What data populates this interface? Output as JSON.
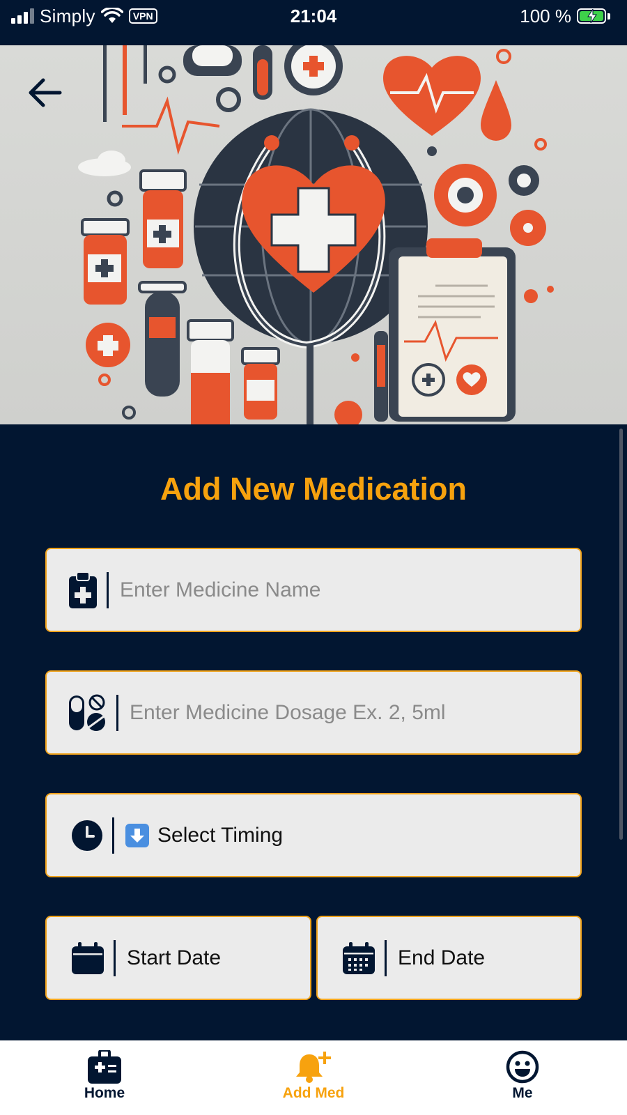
{
  "status_bar": {
    "carrier": "Simply",
    "vpn": "VPN",
    "time": "21:04",
    "battery": "100 %"
  },
  "hero": {
    "image": "medical-health-illustration"
  },
  "form": {
    "title": "Add New Medication",
    "medicine_name": {
      "placeholder": "Enter Medicine Name",
      "icon": "clipboard-medical-icon"
    },
    "dosage": {
      "placeholder": "Enter Medicine Dosage Ex. 2, 5ml",
      "icon": "pills-icon"
    },
    "timing": {
      "value": "Select Timing",
      "icon": "clock-icon",
      "emoji": "down-arrow-emoji"
    },
    "start_date": {
      "value": "Start Date",
      "icon": "calendar-icon"
    },
    "end_date": {
      "value": "End Date",
      "icon": "calendar-grid-icon"
    }
  },
  "bottom_nav": {
    "items": [
      {
        "label": "Home",
        "icon": "medical-kit-icon",
        "active": false
      },
      {
        "label": "Add Med",
        "icon": "bell-plus-icon",
        "active": true
      },
      {
        "label": "Me",
        "icon": "smiley-icon",
        "active": false
      }
    ]
  },
  "colors": {
    "background": "#021631",
    "accent": "#f7a20e",
    "field_bg": "#ebebeb",
    "field_border": "#f0a31b"
  }
}
